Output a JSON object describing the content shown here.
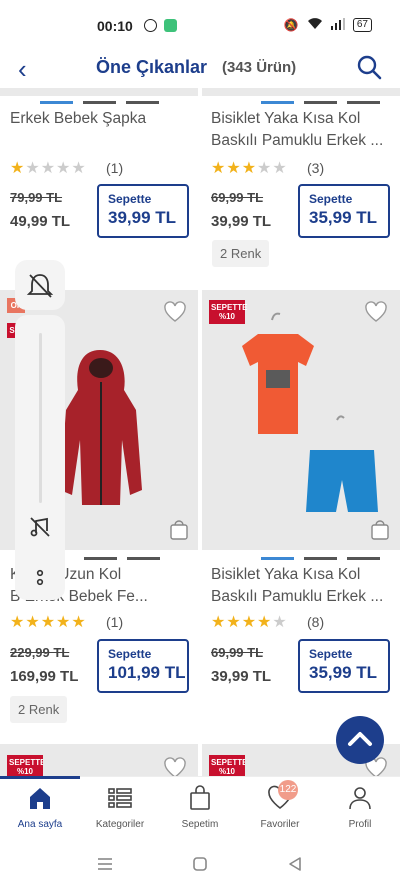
{
  "status": {
    "time": "00:10",
    "battery": "67"
  },
  "header": {
    "title": "Öne Çıkanlar",
    "count": "(343 Ürün)"
  },
  "products": [
    {
      "name_line1": "Erkek Bebek Şapka",
      "name_line2": "",
      "rating": 1,
      "review_count": "(1)",
      "old_price": "79,99 TL",
      "price": "49,99 TL",
      "basket_label": "Sepette",
      "basket_price": "39,99 TL",
      "colors": ""
    },
    {
      "name_line1": "Bisiklet Yaka Kısa Kol",
      "name_line2": "Baskılı Pamuklu Erkek ...",
      "rating": 3,
      "review_count": "(3)",
      "old_price": "69,99 TL",
      "price": "39,99 TL",
      "basket_label": "Sepette",
      "basket_price": "35,99 TL",
      "colors": "2 Renk"
    },
    {
      "name_line1": "K     onlu Uzun Kol",
      "name_line2": "B     Erkek Bebek Fe...",
      "rating": 5,
      "review_count": "(1)",
      "old_price": "229,99 TL",
      "price": "169,99 TL",
      "basket_label": "Sepette",
      "basket_price": "101,99 TL",
      "colors": "2 Renk",
      "badge_line1": "Ok",
      "badge_line2": "Ok",
      "badge_text": "S"
    },
    {
      "name_line1": "Bisiklet Yaka Kısa Kol",
      "name_line2": "Baskılı Pamuklu Erkek ...",
      "rating": 4,
      "review_count": "(8)",
      "old_price": "69,99 TL",
      "price": "39,99 TL",
      "basket_label": "Sepette",
      "basket_price": "35,99 TL",
      "colors": "",
      "badge_line1": "SEPETTE",
      "badge_line2": "%10"
    }
  ],
  "next_row_badges": [
    {
      "line1": "SEPETTE",
      "line2": "%10"
    },
    {
      "line1": "SEPETTE",
      "line2": "%10"
    }
  ],
  "tabbar": {
    "home": "Ana sayfa",
    "categories": "Kategoriler",
    "cart": "Sepetim",
    "favorites": "Favoriler",
    "favorites_badge": "122",
    "profile": "Profil"
  },
  "colors": {
    "brand": "#1d3e8c",
    "star": "#f2b21b",
    "badge_red": "#c8102e"
  }
}
